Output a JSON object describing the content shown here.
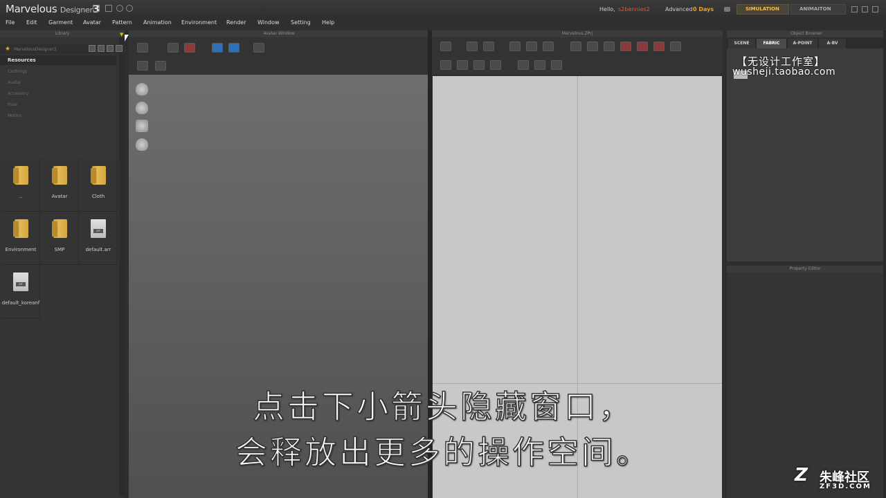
{
  "app": {
    "name": "Marvelous",
    "sub": "Designer",
    "version": "3"
  },
  "user": {
    "hello": "Hello,",
    "name": "s2bennies2",
    "license": "Advanced",
    "days": "0 Days"
  },
  "modes": {
    "simulation": "SIMULATION",
    "animation": "ANIMAITON"
  },
  "menu": [
    "File",
    "Edit",
    "Garment",
    "Avatar",
    "Pattern",
    "Animation",
    "Environment",
    "Render",
    "Window",
    "Setting",
    "Help"
  ],
  "library": {
    "title": "Library",
    "path": "MarvelousDesigner3",
    "resources_label": "Resources",
    "tree": [
      "Clothings",
      "Avatar",
      "Accessory",
      "Pose",
      "Motion"
    ],
    "items": [
      {
        "label": "..",
        "kind": "folder"
      },
      {
        "label": "Avatar",
        "kind": "folder"
      },
      {
        "label": "Cloth",
        "kind": "folder"
      },
      {
        "label": "Environment",
        "kind": "folder"
      },
      {
        "label": "SMP",
        "kind": "folder"
      },
      {
        "label": "default.arr",
        "kind": "file"
      },
      {
        "label": "default_koreanf",
        "kind": "file"
      }
    ]
  },
  "avatar_window": {
    "title": "Avatar Window"
  },
  "pattern_window": {
    "title": "Marvelous.ZPrj"
  },
  "object_browser": {
    "title": "Object Browser",
    "tabs": [
      "SCENE",
      "FABRIC",
      "A-POINT",
      "A-BV"
    ],
    "active_tab": "FABRIC"
  },
  "property_editor": {
    "title": "Property Editor"
  },
  "watermark": {
    "cn": "【无设计工作室】",
    "url": "wusheji.taobao.com"
  },
  "subtitles": {
    "line1": "点击下小箭头隐藏窗口，",
    "line2": "会释放出更多的操作空间。"
  },
  "corner_logo": {
    "title": "朱峰社区",
    "url": "ZF3D.COM"
  }
}
